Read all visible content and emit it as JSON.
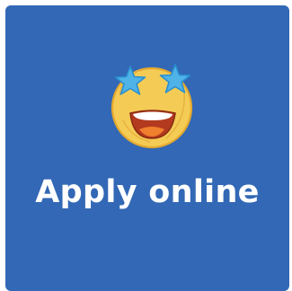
{
  "tile": {
    "label": "Apply online",
    "background_color": "#3268b5",
    "icon": "star-struck-face-icon"
  }
}
